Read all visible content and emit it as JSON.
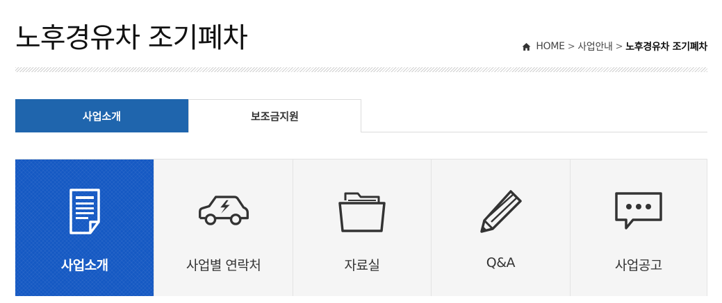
{
  "header": {
    "title": "노후경유차 조기폐차"
  },
  "breadcrumb": {
    "home": "HOME",
    "separator": ">",
    "level1": "사업안내",
    "current": "노후경유차 조기폐차"
  },
  "tabs": [
    {
      "label": "사업소개",
      "active": true
    },
    {
      "label": "보조금지원",
      "active": false
    }
  ],
  "cards": [
    {
      "label": "사업소개",
      "icon": "document-icon",
      "active": true
    },
    {
      "label": "사업별 연락처",
      "icon": "car-icon",
      "active": false
    },
    {
      "label": "자료실",
      "icon": "folder-icon",
      "active": false
    },
    {
      "label": "Q&A",
      "icon": "pencil-icon",
      "active": false
    },
    {
      "label": "사업공고",
      "icon": "speech-bubble-icon",
      "active": false
    }
  ],
  "colors": {
    "tab_active": "#1f65ad",
    "card_active": "#1559c3",
    "card_bg": "#f5f5f5"
  }
}
